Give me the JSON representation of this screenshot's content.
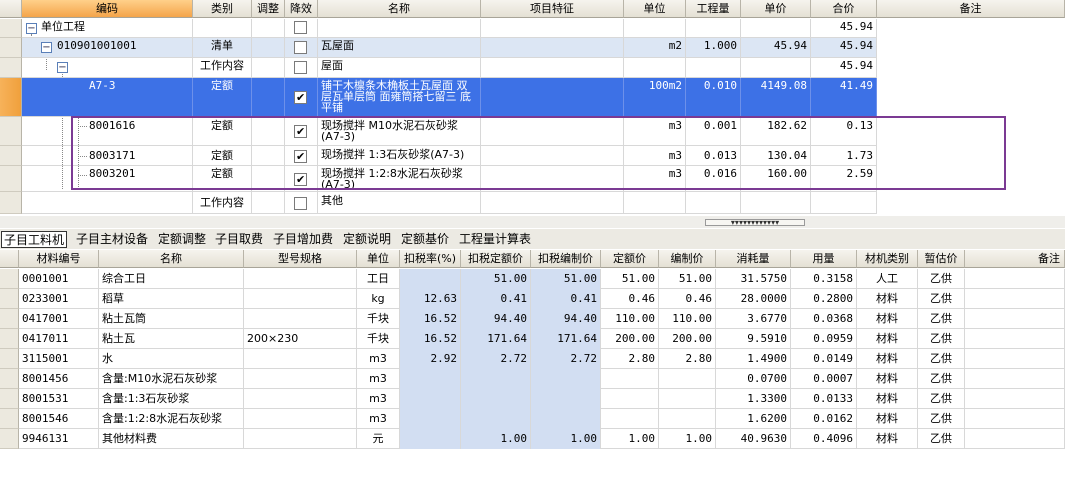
{
  "top_headers": [
    "编码",
    "类别",
    "调整",
    "降效",
    "名称",
    "项目特征",
    "单位",
    "工程量",
    "单价",
    "合价",
    "备注"
  ],
  "top_rows": [
    {
      "code": "单位工程",
      "type": "",
      "adjust": "",
      "checked": false,
      "name": "",
      "feature": "",
      "unit": "",
      "qty": "",
      "price": "",
      "total": "45.94",
      "note": ""
    },
    {
      "code": "010901001001",
      "type": "清单",
      "adjust": "",
      "checked": false,
      "name": "瓦屋面",
      "feature": "",
      "unit": "m2",
      "qty": "1.000",
      "price": "45.94",
      "total": "45.94",
      "note": ""
    },
    {
      "code": "",
      "type": "工作内容",
      "adjust": "",
      "checked": false,
      "name": "屋面",
      "feature": "",
      "unit": "",
      "qty": "",
      "price": "",
      "total": "45.94",
      "note": ""
    },
    {
      "code": "A7-3",
      "type": "定额",
      "adjust": "",
      "checked": true,
      "name": "铺干木檩条木桷板土瓦屋面 双层瓦单层筒 面雍筒搭七留三 底平铺",
      "feature": "",
      "unit": "100m2",
      "qty": "0.010",
      "price": "4149.08",
      "total": "41.49",
      "note": ""
    },
    {
      "code": "8001616",
      "type": "定额",
      "adjust": "",
      "checked": true,
      "name": "现场搅拌 M10水泥石灰砂浆(A7-3)",
      "feature": "",
      "unit": "m3",
      "qty": "0.001",
      "price": "182.62",
      "total": "0.13",
      "note": ""
    },
    {
      "code": "8003171",
      "type": "定额",
      "adjust": "",
      "checked": true,
      "name": "现场搅拌 1:3石灰砂浆(A7-3)",
      "feature": "",
      "unit": "m3",
      "qty": "0.013",
      "price": "130.04",
      "total": "1.73",
      "note": ""
    },
    {
      "code": "8003201",
      "type": "定额",
      "adjust": "",
      "checked": true,
      "name": "现场搅拌 1:2:8水泥石灰砂浆(A7-3)",
      "feature": "",
      "unit": "m3",
      "qty": "0.016",
      "price": "160.00",
      "total": "2.59",
      "note": ""
    },
    {
      "code": "",
      "type": "工作内容",
      "adjust": "",
      "checked": false,
      "name": "其他",
      "feature": "",
      "unit": "",
      "qty": "",
      "price": "",
      "total": "",
      "note": ""
    }
  ],
  "tabs": [
    "子目工料机",
    "子目主材设备",
    "定额调整",
    "子目取费",
    "子目增加费",
    "定额说明",
    "定额基价",
    "工程量计算表"
  ],
  "bottom_headers": [
    "材料编号",
    "名称",
    "型号规格",
    "单位",
    "扣税率(%)",
    "扣税定额价",
    "扣税编制价",
    "定额价",
    "编制价",
    "消耗量",
    "用量",
    "材机类别",
    "暂估价",
    "备注"
  ],
  "bottom_rows": [
    [
      "0001001",
      "综合工日",
      "",
      "工日",
      "",
      "51.00",
      "51.00",
      "51.00",
      "51.00",
      "31.5750",
      "0.3158",
      "人工",
      "乙供",
      ""
    ],
    [
      "0233001",
      "稻草",
      "",
      "kg",
      "12.63",
      "0.41",
      "0.41",
      "0.46",
      "0.46",
      "28.0000",
      "0.2800",
      "材料",
      "乙供",
      ""
    ],
    [
      "0417001",
      "粘土瓦筒",
      "",
      "千块",
      "16.52",
      "94.40",
      "94.40",
      "110.00",
      "110.00",
      "3.6770",
      "0.0368",
      "材料",
      "乙供",
      ""
    ],
    [
      "0417011",
      "粘土瓦",
      "200×230",
      "千块",
      "16.52",
      "171.64",
      "171.64",
      "200.00",
      "200.00",
      "9.5910",
      "0.0959",
      "材料",
      "乙供",
      ""
    ],
    [
      "3115001",
      "水",
      "",
      "m3",
      "2.92",
      "2.72",
      "2.72",
      "2.80",
      "2.80",
      "1.4900",
      "0.0149",
      "材料",
      "乙供",
      ""
    ],
    [
      "8001456",
      "含量:M10水泥石灰砂浆",
      "",
      "m3",
      "",
      "",
      "",
      "",
      "",
      "0.0700",
      "0.0007",
      "材料",
      "乙供",
      ""
    ],
    [
      "8001531",
      "含量:1:3石灰砂浆",
      "",
      "m3",
      "",
      "",
      "",
      "",
      "",
      "1.3300",
      "0.0133",
      "材料",
      "乙供",
      ""
    ],
    [
      "8001546",
      "含量:1:2:8水泥石灰砂浆",
      "",
      "m3",
      "",
      "",
      "",
      "",
      "",
      "1.6200",
      "0.0162",
      "材料",
      "乙供",
      ""
    ],
    [
      "9946131",
      "其他材料费",
      "",
      "元",
      "",
      "1.00",
      "1.00",
      "1.00",
      "1.00",
      "40.9630",
      "0.4096",
      "材料",
      "乙供",
      ""
    ]
  ],
  "icons": {
    "tree_minus": "−",
    "splitter": "▾▾▾▾▾▾▾▾▾▾▾▾"
  }
}
